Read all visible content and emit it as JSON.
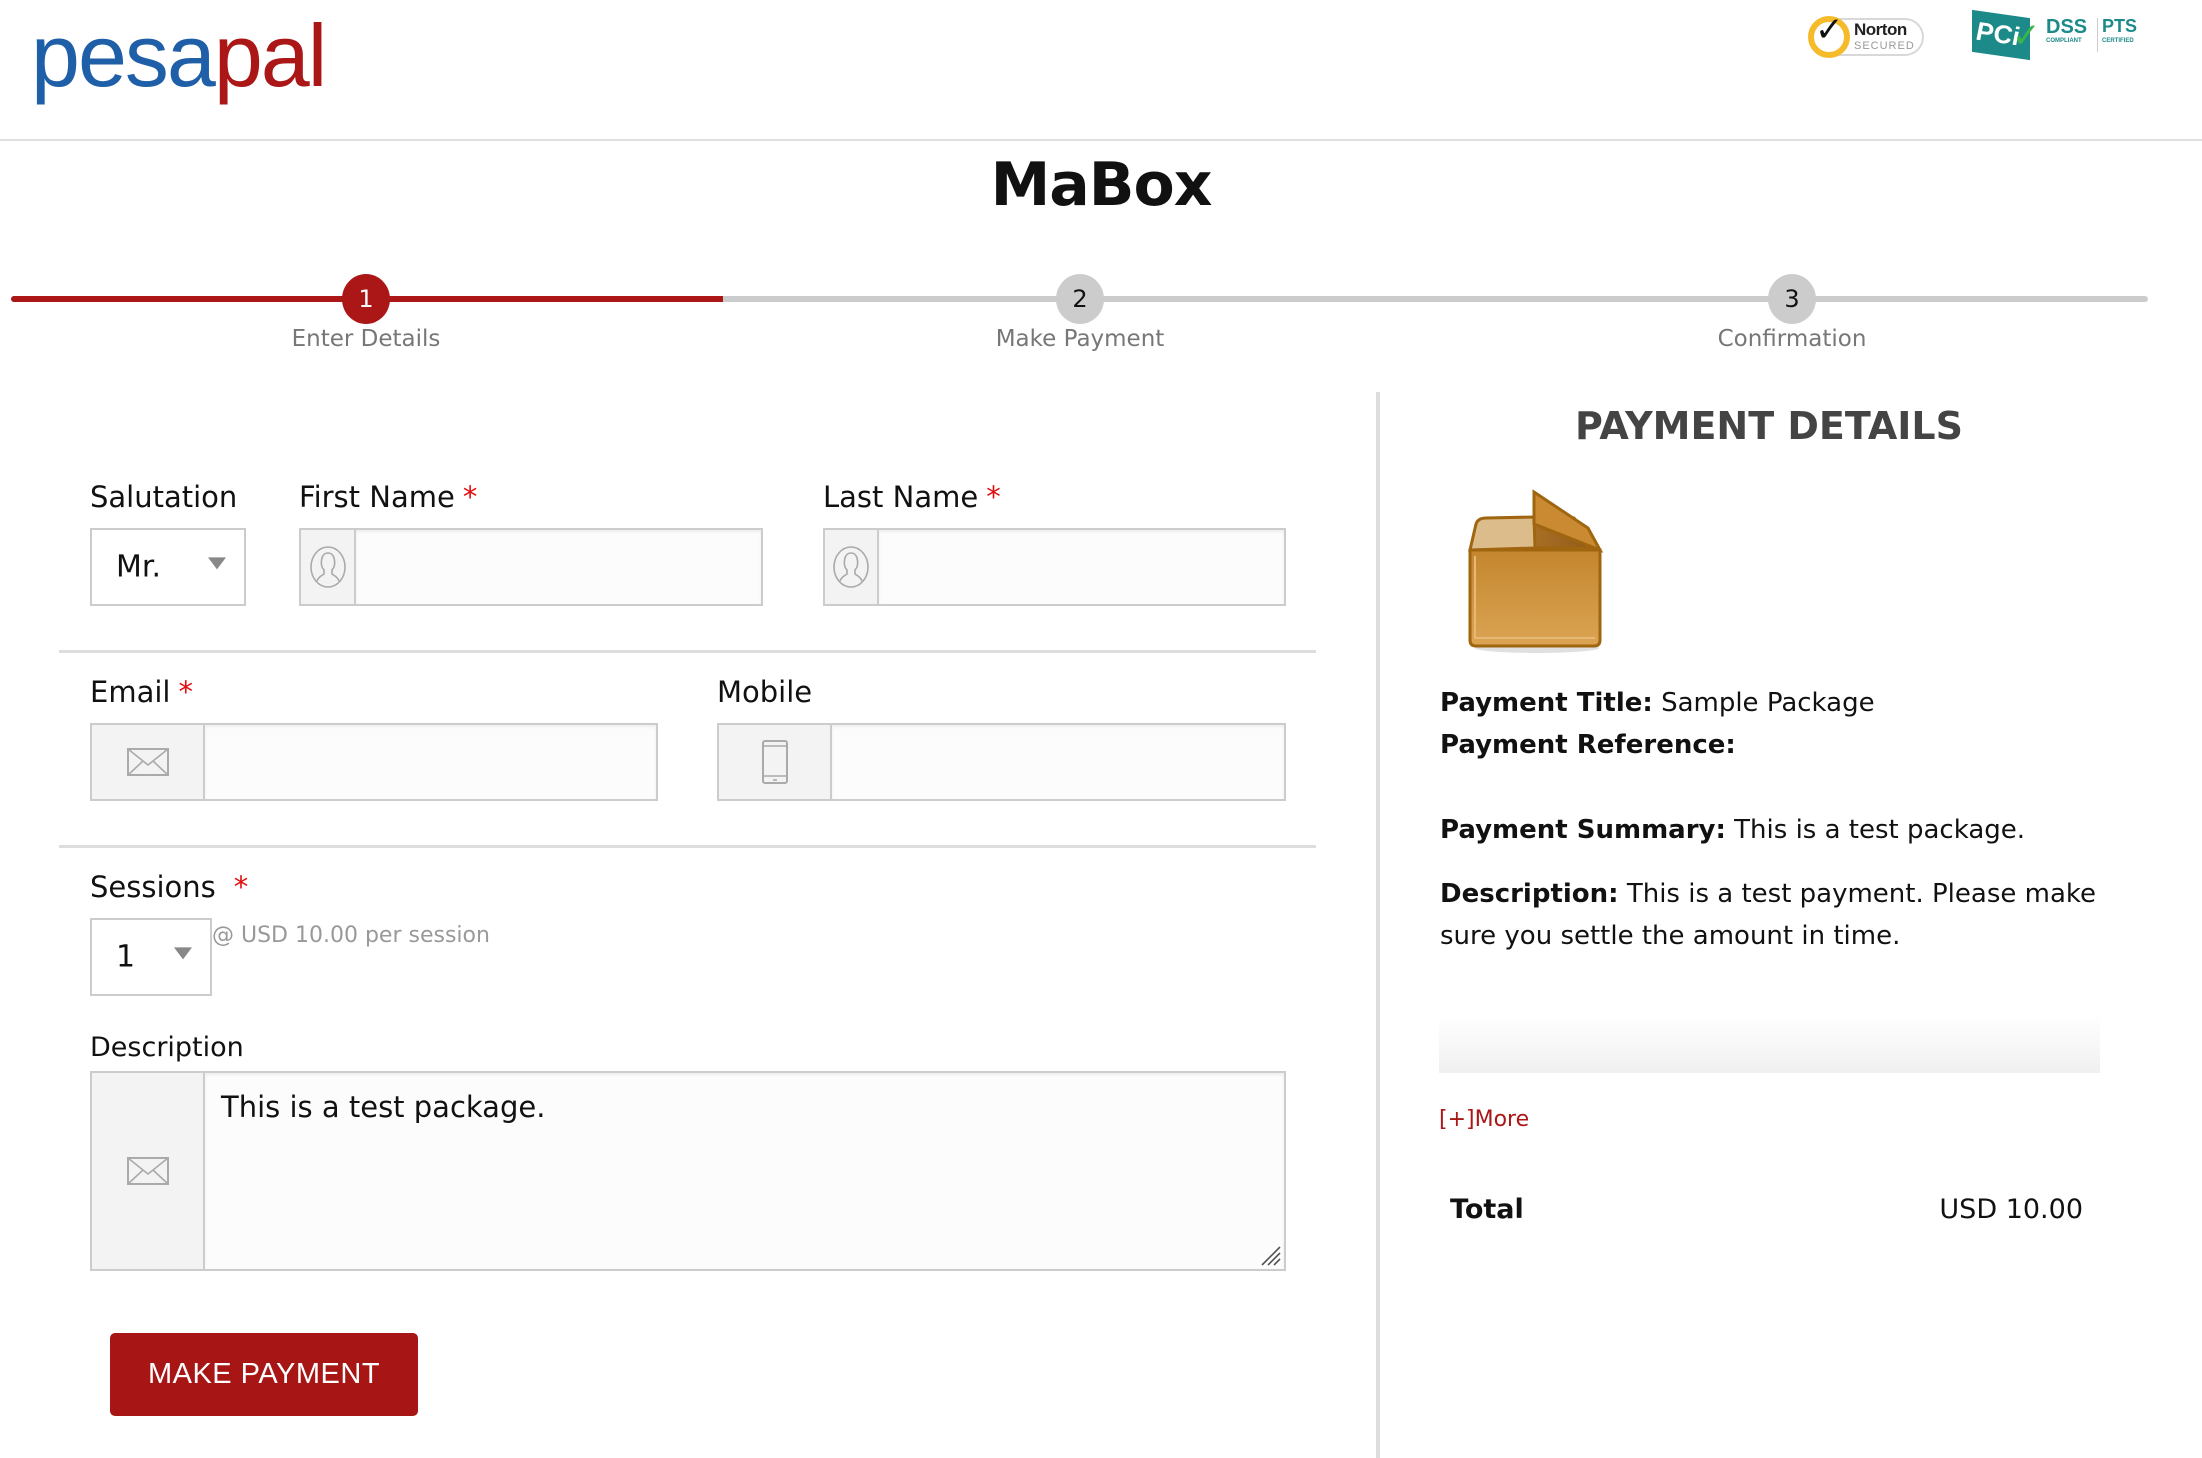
{
  "brand": {
    "logo_part1": "pesa",
    "logo_part2": "pal",
    "badges": {
      "norton_title": "Norton",
      "norton_sub": "SECURED",
      "pci_flag": "PCi",
      "pci_dss": "DSS",
      "pci_dss_sub": "COMPLIANT",
      "pci_pts": "PTS",
      "pci_pts_sub": "CERTIFIED"
    }
  },
  "page": {
    "title": "MaBox"
  },
  "steps": {
    "progress_fraction": 0.333,
    "items": [
      {
        "number": "1",
        "label": "Enter Details",
        "state": "active"
      },
      {
        "number": "2",
        "label": "Make Payment",
        "state": "todo"
      },
      {
        "number": "3",
        "label": "Confirmation",
        "state": "todo"
      }
    ]
  },
  "form": {
    "salutation": {
      "label": "Salutation",
      "value": "Mr."
    },
    "first_name": {
      "label": "First Name",
      "required": "*",
      "value": ""
    },
    "last_name": {
      "label": "Last Name",
      "required": "*",
      "value": ""
    },
    "email": {
      "label": "Email",
      "required": "*",
      "value": ""
    },
    "mobile": {
      "label": "Mobile",
      "value": ""
    },
    "sessions": {
      "label": "Sessions",
      "required": "*",
      "value": "1",
      "note": "@ USD 10.00 per session"
    },
    "description": {
      "label": "Description",
      "value": "This is a test package."
    },
    "submit_label": "MAKE PAYMENT"
  },
  "payment_details": {
    "heading": "PAYMENT DETAILS",
    "title_label": "Payment Title:",
    "title_value": "Sample Package",
    "reference_label": "Payment Reference:",
    "reference_value": "",
    "summary_label": "Payment Summary:",
    "summary_value": "This is a test package.",
    "description_label": "Description:",
    "description_value": "This is a test payment. Please make sure you settle the amount in time.",
    "more_link": "[+]More",
    "total_label": "Total",
    "total_value": "USD 10.00"
  },
  "colors": {
    "accent": "#ab1717",
    "brand_blue": "#1f5fa8",
    "inactive_step": "#cccccc",
    "required": "#e01010"
  }
}
